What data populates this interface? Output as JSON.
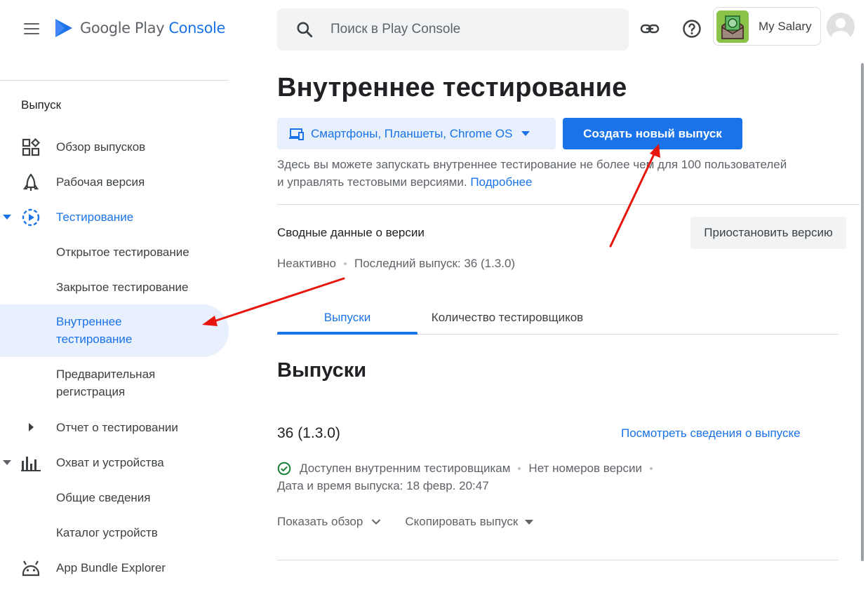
{
  "header": {
    "logo_main": "Google Play",
    "logo_accent": "Console",
    "search_placeholder": "Поиск в Play Console",
    "app_name": "My Salary"
  },
  "sidebar": {
    "section": "Выпуск",
    "items": [
      {
        "label": "Обзор выпусков",
        "icon": "dashboard-icon"
      },
      {
        "label": "Рабочая версия",
        "icon": "production-icon"
      },
      {
        "label": "Тестирование",
        "icon": "testing-icon"
      },
      {
        "label": "Открытое тестирование"
      },
      {
        "label": "Закрытое тестирование"
      },
      {
        "label": "Внутреннее тестирование",
        "line1": "Внутреннее",
        "line2": "тестирование"
      },
      {
        "label": "Предварительная регистрация",
        "line1": "Предварительная",
        "line2": "регистрация"
      },
      {
        "label": "Отчет о тестировании"
      },
      {
        "label": "Охват и устройства",
        "icon": "bar-chart-icon"
      },
      {
        "label": "Общие сведения"
      },
      {
        "label": "Каталог устройств"
      },
      {
        "label": "App Bundle Explorer",
        "icon": "android-icon"
      }
    ]
  },
  "main": {
    "title": "Внутреннее тестирование",
    "device_filter": "Смартфоны, Планшеты, Chrome OS",
    "create_button": "Создать новый выпуск",
    "description_line1": "Здесь вы можете запускать внутреннее тестирование не более чем для 100 пользователей",
    "description_line2": "и управлять тестовыми версиями.",
    "learn_more": "Подробнее",
    "summary_title": "Сводные данные о версии",
    "pause_button": "Приостановить версию",
    "status": "Неактивно",
    "last_release": "Последний выпуск: 36 (1.3.0)",
    "tabs": [
      {
        "label": "Выпуски"
      },
      {
        "label": "Количество тестировщиков"
      }
    ],
    "releases_title": "Выпуски",
    "release": {
      "version": "36 (1.3.0)",
      "details_link": "Посмотреть сведения о выпуске",
      "availability": "Доступен внутренним тестировщикам",
      "version_codes": "Нет номеров версии",
      "date": "Дата и время выпуска: 18 февр. 20:47",
      "show_overview": "Показать обзор",
      "copy_release": "Скопировать выпуск"
    }
  },
  "colors": {
    "accent": "#1a73e8",
    "active_bg": "#e8f0fe",
    "annotation": "#e8150d",
    "success": "#188038"
  }
}
